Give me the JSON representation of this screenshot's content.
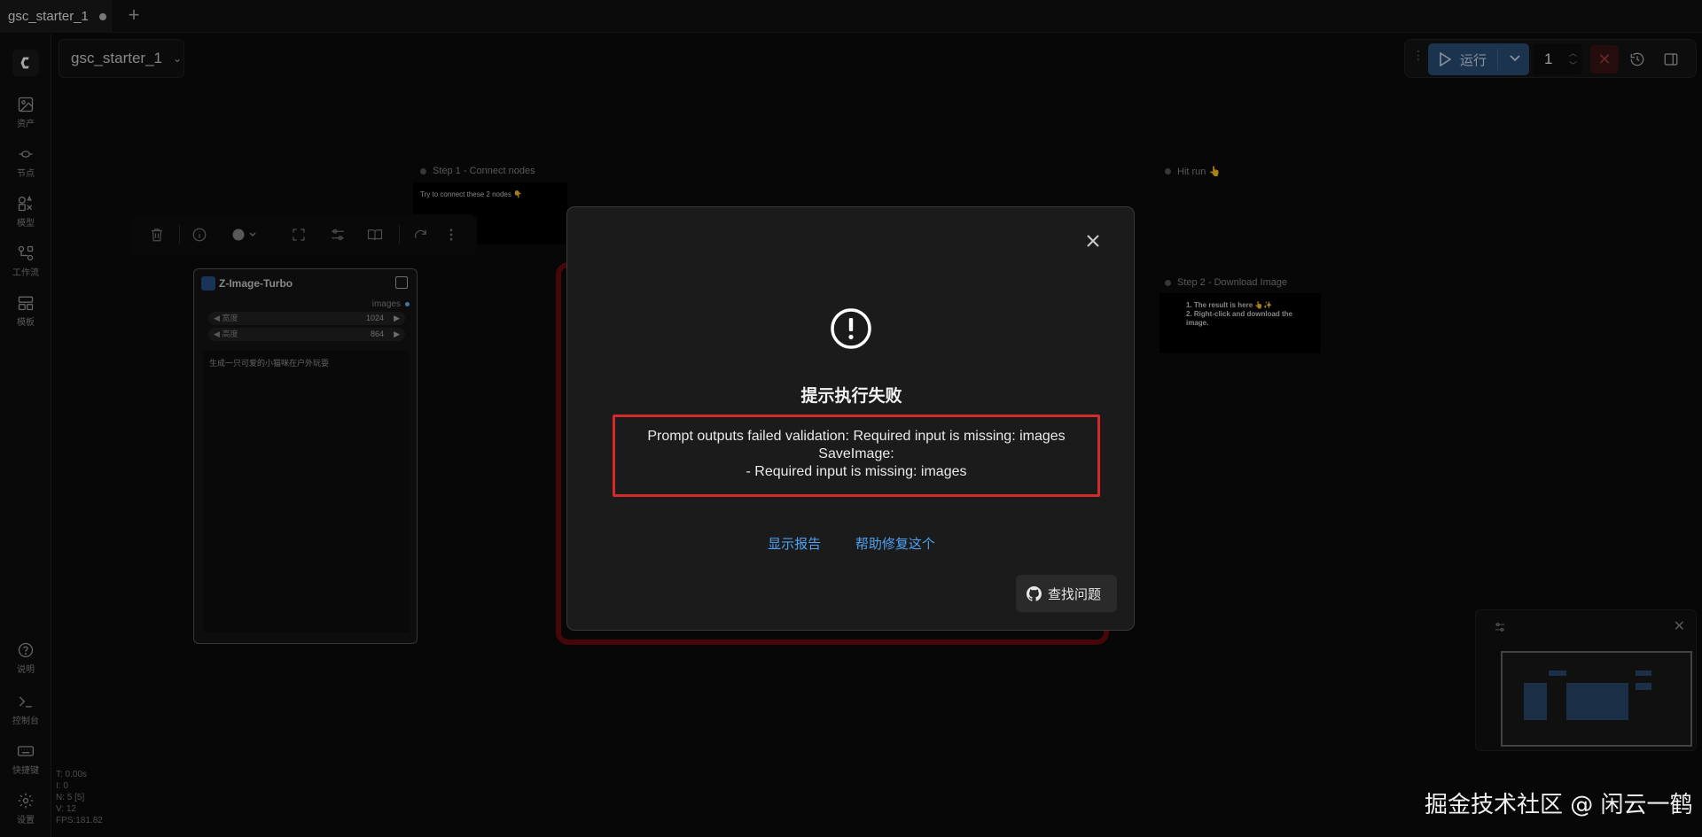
{
  "tabbar": {
    "tab_title": "gsc_starter_1",
    "add_label": "+"
  },
  "sidebar": {
    "items": [
      {
        "label": "资产",
        "icon": "image-icon"
      },
      {
        "label": "节点",
        "icon": "node-icon"
      },
      {
        "label": "模型",
        "icon": "model-icon"
      },
      {
        "label": "工作流",
        "icon": "workflow-icon"
      },
      {
        "label": "模板",
        "icon": "template-icon"
      }
    ],
    "bottom_items": [
      {
        "label": "说明",
        "icon": "help-icon"
      },
      {
        "label": "控制台",
        "icon": "terminal-icon"
      },
      {
        "label": "快捷键",
        "icon": "keyboard-icon"
      },
      {
        "label": "设置",
        "icon": "settings-icon"
      }
    ]
  },
  "stats": {
    "t": "T: 0.00s",
    "i": "I: 0",
    "n": "N: 5 [5]",
    "v": "V: 12",
    "fps": "FPS:181.82"
  },
  "workflow": {
    "title": "gsc_starter_1"
  },
  "toolbar": {
    "run_label": "运行",
    "count": "1"
  },
  "canvas": {
    "step1": {
      "title": "Step 1 - Connect nodes",
      "body": "Try to connect these 2 nodes 👇"
    },
    "hitrun": {
      "title": "Hit run 👆"
    },
    "step2": {
      "title": "Step 2 - Download Image",
      "line1": "1. The result is here 👆✨",
      "line2": "2. Right-click and download the image."
    },
    "node": {
      "title": "Z-Image-Turbo",
      "output": "images",
      "width_label": "宽度",
      "width_value": "1024",
      "height_label": "高度",
      "height_value": "864",
      "prompt": "生成一只可爱的小猫咪在户外玩耍"
    }
  },
  "dialog": {
    "title": "提示执行失败",
    "message_line1": "Prompt outputs failed validation: Required input is missing: images",
    "message_line2": "SaveImage:",
    "message_line3": "- Required input is missing: images",
    "link_report": "显示报告",
    "link_fix": "帮助修复这个",
    "find_issue": "查找问题"
  },
  "watermark": "掘金技术社区 @ 闲云一鹤",
  "colors": {
    "accent": "#4ea2f0",
    "error_border": "#d32a2a",
    "run_button": "#2b4f78"
  }
}
